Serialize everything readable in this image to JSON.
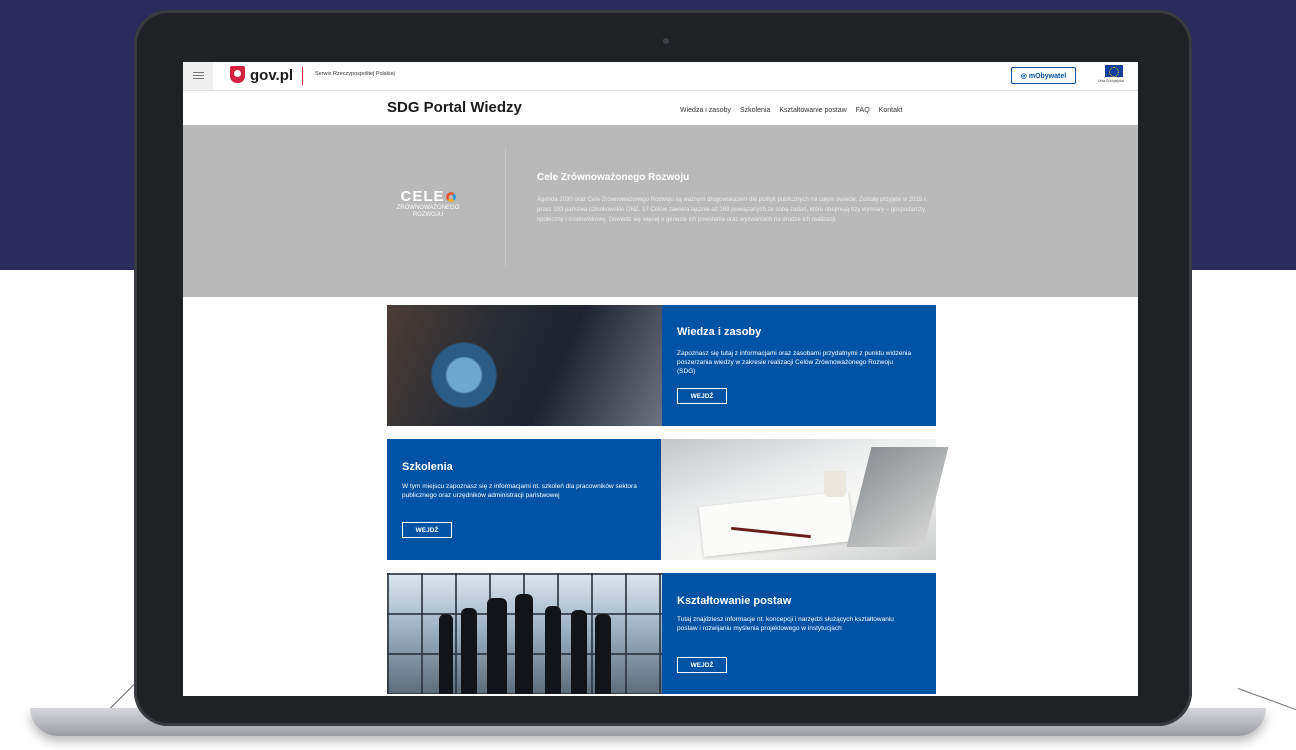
{
  "gov_bar": {
    "logo": "gov.pl",
    "tagline": "Serwis Rzeczypospolitej Polskiej",
    "mobywatel_label": "mObywatel",
    "eu_label": "Unia Europejska"
  },
  "portal": {
    "title": "SDG Portal Wiedzy",
    "nav": [
      "Wiedza i zasoby",
      "Szkolenia",
      "Kształtowanie postaw",
      "FAQ",
      "Kontakt"
    ]
  },
  "hero": {
    "logo_main": "CELE",
    "logo_sub_1": "ZRÓWNOWAŻONEGO",
    "logo_sub_2": "ROZWOJU",
    "title": "Cele Zrównoważonego Rozwoju",
    "text": "Agenda 2030 oraz Cele Zrównoważonego Rozwoju są ważnym drogowskazem dla polityk publicznych na całym świecie. Zostały przyjęte w 2015 r. przez 193 państwa członkowskie ONZ. 17 Celów zawiera łącznie aż 169 powiązanych ze sobą zadań, które obejmują trzy wymiary – gospodarczy, społeczny i środowiskowy. Dowiedz się więcej o genezie ich powstania oraz wyzwaniach na drodze ich realizacji."
  },
  "cards": [
    {
      "title": "Wiedza i zasoby",
      "text": "Zapoznasz się tutaj z informacjami oraz zasobami przydatnymi z punktu widzenia poszerzania wiedzy w zakresie realizacji Celów Zrównoważonego Rozwoju (SDG)",
      "button": "WEJDŹ"
    },
    {
      "title": "Szkolenia",
      "text": "W tym miejscu zapoznasz się z informacjami nt. szkoleń dla pracowników sektora publicznego oraz urzędników administracji państwowej",
      "button": "WEJDŹ"
    },
    {
      "title": "Kształtowanie postaw",
      "text": "Tutaj znajdziesz informacje nt. koncepcji i narzędzi służących kształtowaniu postaw i rozwijaniu myślenia projektowego w instytucjach",
      "button": "WEJDŹ"
    }
  ],
  "colors": {
    "background_top": "#2a2b5c",
    "primary_blue": "#0052a5",
    "hero_grey": "#b9b9b9",
    "gov_red": "#d4213d"
  }
}
